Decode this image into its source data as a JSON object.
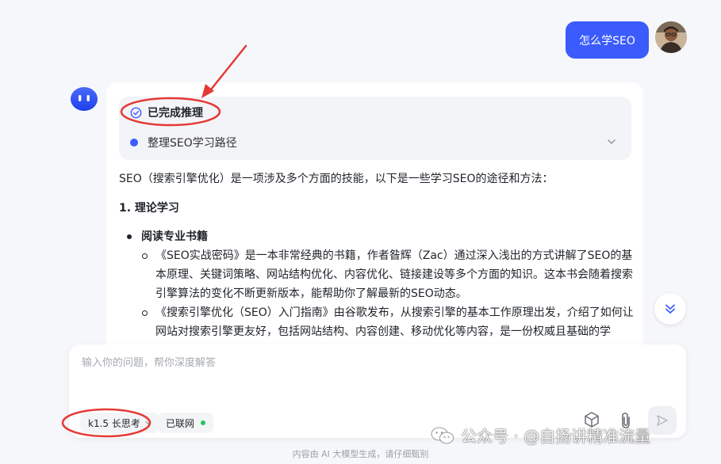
{
  "chat": {
    "user_message": "怎么学SEO",
    "reasoning": {
      "status": "已完成推理",
      "step": "整理SEO学习路径"
    },
    "answer": {
      "intro": "SEO（搜索引擎优化）是一项涉及多个方面的技能，以下是一些学习SEO的途径和方法：",
      "section_title": "1. 理论学习",
      "bullet": "阅读专业书籍",
      "sub_items": [
        "《SEO实战密码》是一本非常经典的书籍，作者昝辉（Zac）通过深入浅出的方式讲解了SEO的基本原理、关键词策略、网站结构优化、内容优化、链接建设等多个方面的知识。这本书会随着搜索引擎算法的变化不断更新版本，能帮助你了解最新的SEO动态。",
        "《搜索引擎优化（SEO）入门指南》由谷歌发布，从搜索引擎的基本工作原理出发，介绍了如何让网站对搜索引擎更友好，包括网站结构、内容创建、移动优化等内容，是一份权威且基础的学"
      ]
    }
  },
  "composer": {
    "placeholder": "输入你的问题，帮你深度解答",
    "model_label": "k1.5 长思考",
    "web_label": "已联网"
  },
  "footer": {
    "note": "内容由 AI 大模型生成，请仔细甄别"
  },
  "watermark": {
    "text": "公众号 · @自扬讲精准流量"
  },
  "colors": {
    "accent": "#3b5bfd",
    "annotation": "#e53935",
    "online": "#22c55e"
  }
}
